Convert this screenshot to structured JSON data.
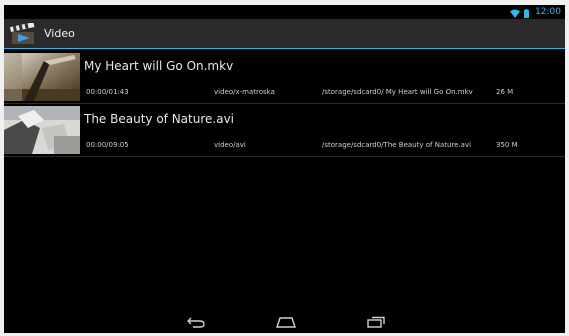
{
  "status_bar": {
    "time": "12:00",
    "accent": "#33b5e5"
  },
  "action_bar": {
    "title": "Video",
    "icon": "clapperboard-icon"
  },
  "videos": [
    {
      "title": "My Heart will Go On.mkv",
      "duration": "00:00/01:43",
      "mime": "video/x-matroska",
      "path": "/storage/sdcard0/ My Heart will Go On.mkv",
      "size": "26 M"
    },
    {
      "title": "The Beauty of Nature.avi",
      "duration": "00:00/09:05",
      "mime": "video/avi",
      "path": "/storage/sdcard0/The Beauty of Nature.avi",
      "size": "350 M"
    }
  ],
  "nav_bar": {
    "back": "back-icon",
    "home": "home-icon",
    "recents": "recent-apps-icon"
  }
}
